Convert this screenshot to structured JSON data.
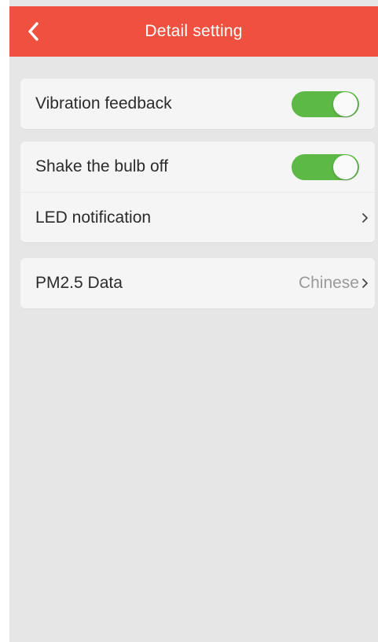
{
  "header": {
    "title": "Detail setting",
    "back_icon": "chevron-left-icon",
    "background_color": "#f0503f"
  },
  "settings": {
    "vibration_feedback": {
      "label": "Vibration feedback",
      "enabled": true
    },
    "shake_bulb_off": {
      "label": "Shake the bulb off",
      "enabled": true
    },
    "led_notification": {
      "label": "LED notification",
      "icon": "chevron-right-icon"
    },
    "pm25_data": {
      "label": "PM2.5 Data",
      "value": "Chinese",
      "icon": "chevron-right-icon"
    }
  },
  "colors": {
    "toggle_on": "#5cb946",
    "page_background": "#e6e6e6",
    "card_background": "#f5f5f5"
  }
}
